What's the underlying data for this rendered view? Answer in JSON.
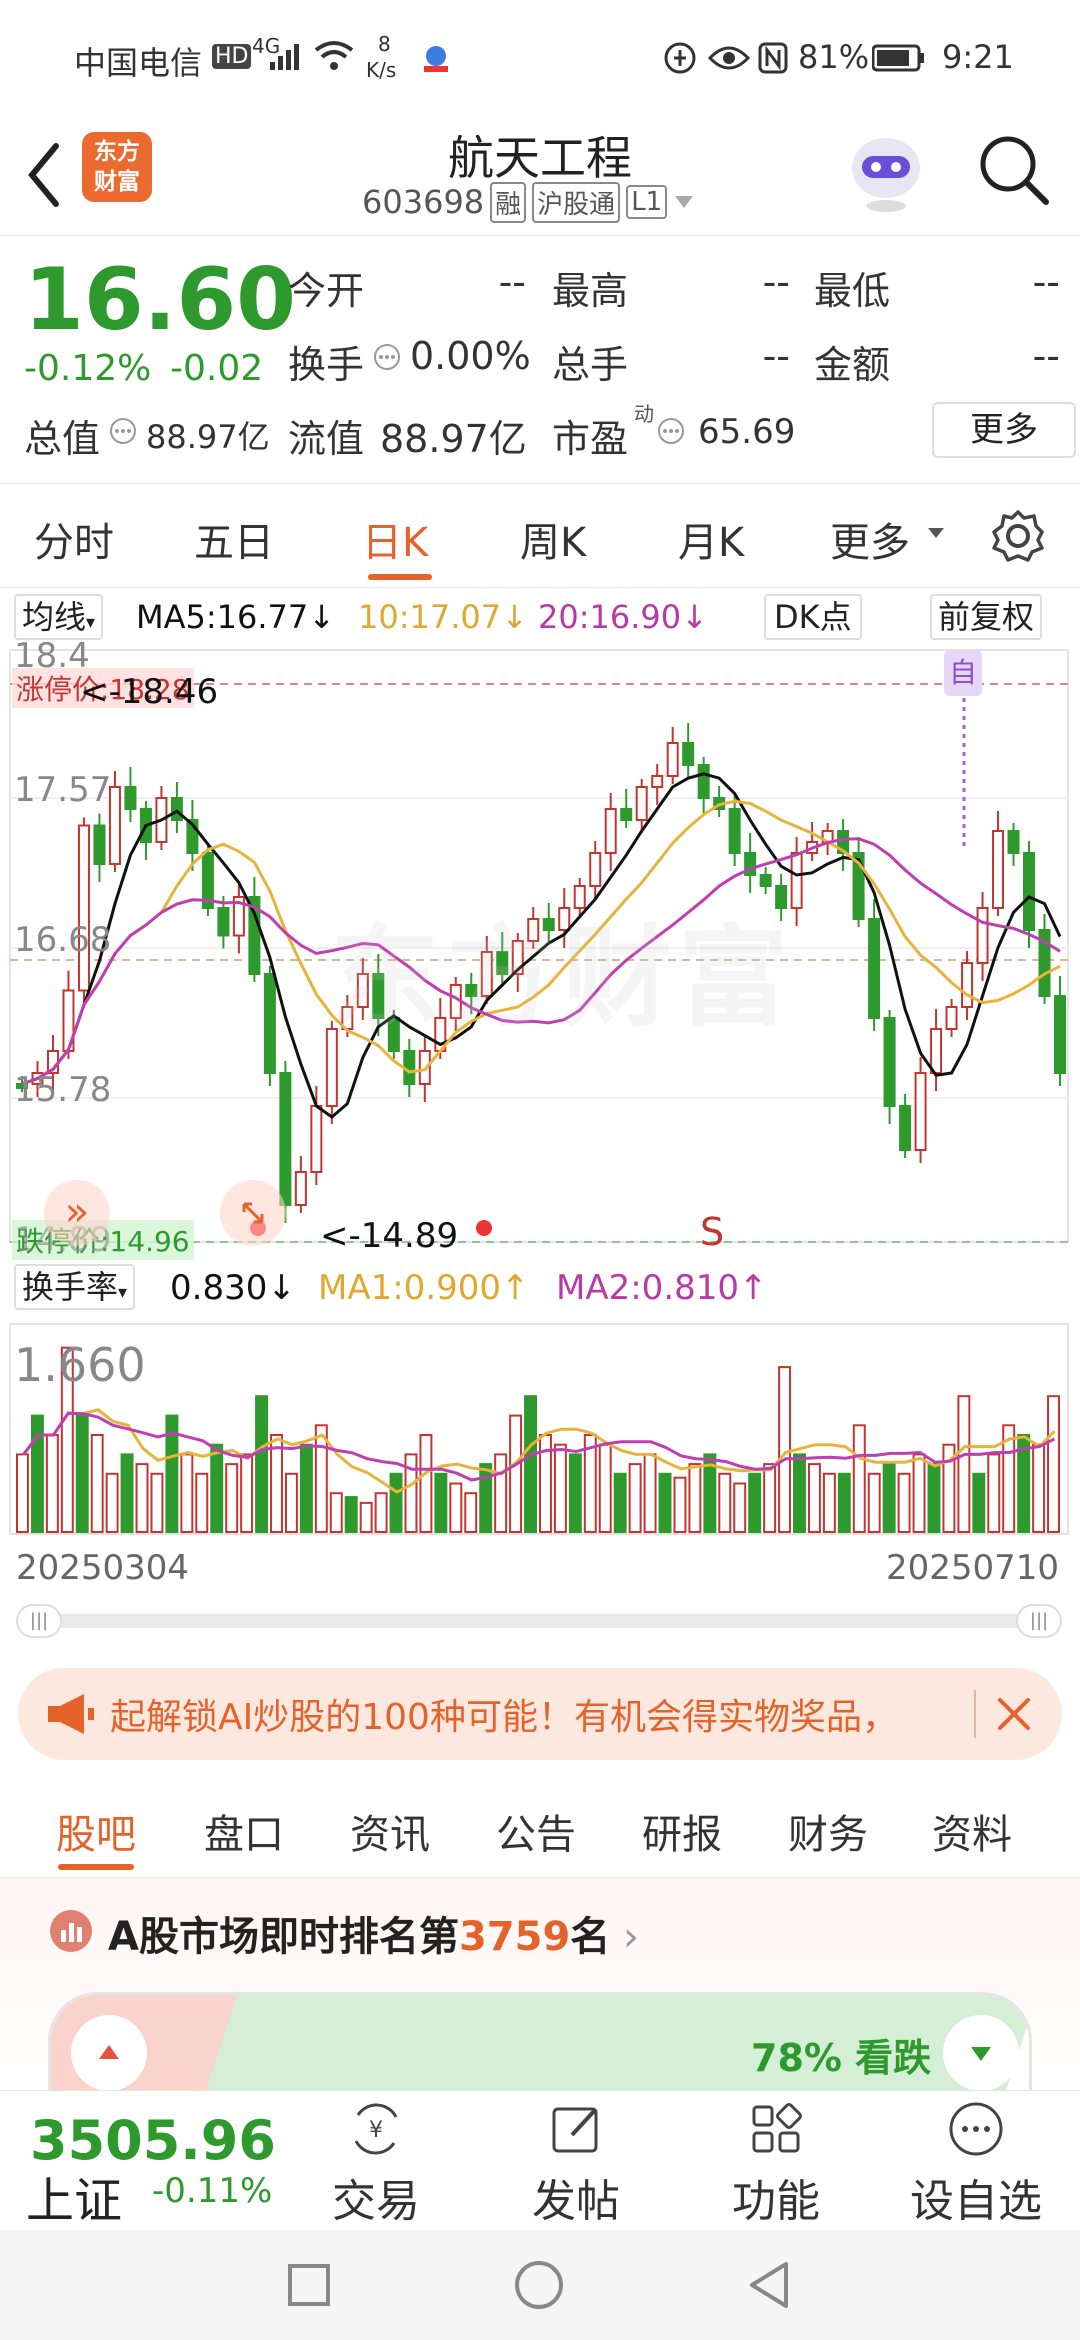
{
  "status_bar": {
    "carrier": "中国电信",
    "hd": "HD",
    "signal": "4G",
    "net_speed_value": "8",
    "net_speed_unit": "K/s",
    "battery": "81%",
    "time": "9:21"
  },
  "header": {
    "logo_line1": "东方",
    "logo_line2": "财富",
    "title": "航天工程",
    "code": "603698",
    "badges": [
      "融",
      "沪股通",
      "L1"
    ]
  },
  "quote": {
    "price": "16.60",
    "change_pct": "-0.12%",
    "change": "-0.02",
    "open_label": "今开",
    "open_value": "--",
    "high_label": "最高",
    "high_value": "--",
    "low_label": "最低",
    "low_value": "--",
    "turnover_label": "换手",
    "turnover_value": "0.00%",
    "volume_label": "总手",
    "volume_value": "--",
    "amount_label": "金额",
    "amount_value": "--",
    "total_mv_label": "总值",
    "total_mv_value": "88.97亿",
    "float_mv_label": "流值",
    "float_mv_value": "88.97亿",
    "pe_label": "市盈",
    "pe_sup": "动",
    "pe_value": "65.69",
    "more_button": "更多"
  },
  "k_tabs": {
    "items": [
      "分时",
      "五日",
      "日K",
      "周K",
      "月K",
      "更多"
    ],
    "active": 2
  },
  "ma_line": {
    "selector": "均线",
    "ma5": "MA5:16.77",
    "ma10": "10:17.07",
    "ma20": "20:16.90",
    "dk_button": "DK点",
    "fq_button": "前复权"
  },
  "kline": {
    "limit_up_label": "涨停价:18.28",
    "limit_down_label": "跌停价:14.96",
    "y_labels": [
      "18.4",
      "17.57",
      "16.68",
      "15.78",
      "14.89"
    ],
    "max_marker": "<-18.46",
    "min_marker": "<-14.89",
    "self_tag": "自",
    "signal_s": "S",
    "watermark": "东方财富"
  },
  "volume_panel": {
    "selector": "换手率",
    "value": "0.830",
    "ma1": "MA1:0.900",
    "ma2": "MA2:0.810",
    "max_label": "1.660",
    "date_start": "20250304",
    "date_end": "20250710"
  },
  "banner": {
    "text": "起解锁AI炒股的100种可能！有机会得实物奖品，"
  },
  "info_tabs": {
    "items": [
      "股吧",
      "盘口",
      "资讯",
      "公告",
      "研报",
      "财务",
      "资料"
    ],
    "active": 0
  },
  "rank": {
    "prefix": "A股市场即时排名第",
    "number": "3759",
    "suffix": "名",
    "bear_text": "78% 看跌"
  },
  "bottom_bar": {
    "index_value": "3505.96",
    "index_name": "上证",
    "index_change": "-0.11%",
    "buttons": [
      "交易",
      "发帖",
      "功能",
      "设自选"
    ]
  },
  "colors": {
    "up": "#c23531",
    "down": "#2e9a2e",
    "accent": "#e5622b",
    "ma5": "#111111",
    "ma10": "#e8b33a",
    "ma20": "#c03fb0"
  }
}
